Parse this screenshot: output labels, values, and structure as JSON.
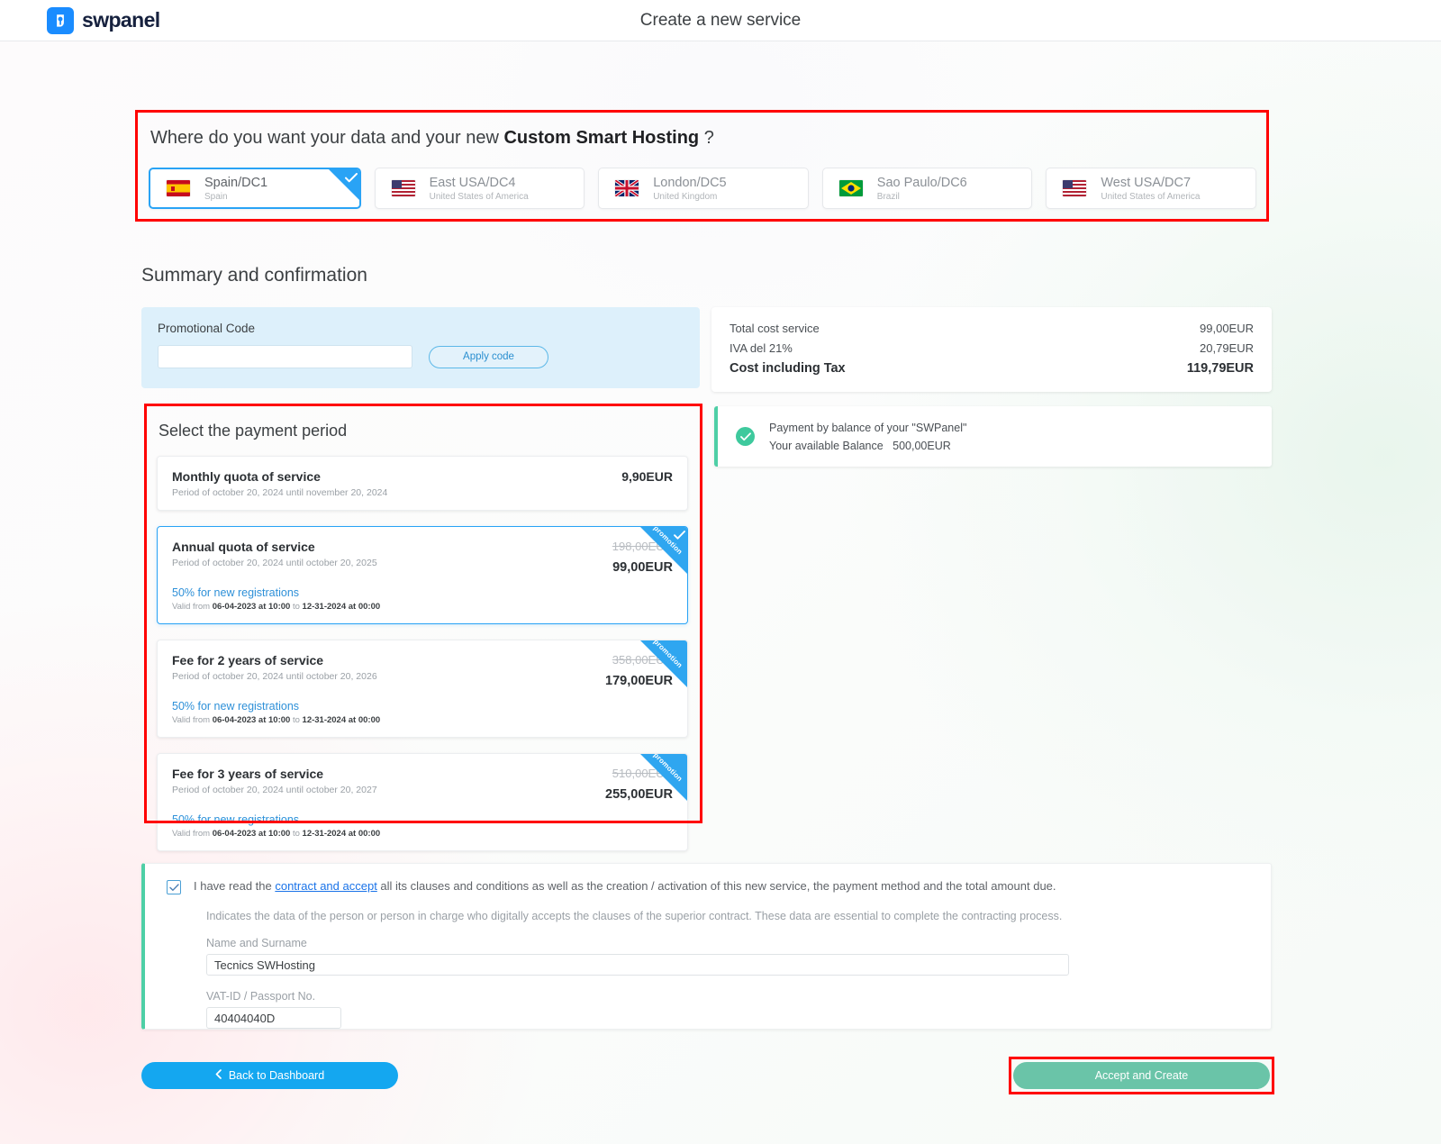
{
  "header": {
    "brand": "swpanel",
    "title": "Create a new service",
    "logo_icon": "swpanel-logo-icon",
    "brand_color": "#1a8cff"
  },
  "datacenter": {
    "question_prefix": "Where do you want your data and your new ",
    "question_bold": "Custom Smart Hosting",
    "question_suffix": " ?",
    "options": [
      {
        "name": "Spain/DC1",
        "country": "Spain",
        "flag": "flag-spain-icon",
        "selected": true
      },
      {
        "name": "East USA/DC4",
        "country": "United States of America",
        "flag": "flag-usa-icon",
        "selected": false
      },
      {
        "name": "London/DC5",
        "country": "United Kingdom",
        "flag": "flag-uk-icon",
        "selected": false
      },
      {
        "name": "Sao Paulo/DC6",
        "country": "Brazil",
        "flag": "flag-brazil-icon",
        "selected": false
      },
      {
        "name": "West USA/DC7",
        "country": "United States of America",
        "flag": "flag-usa-icon",
        "selected": false
      }
    ]
  },
  "summary": {
    "heading": "Summary and confirmation"
  },
  "promo": {
    "label": "Promotional Code",
    "value": "",
    "placeholder": "",
    "apply_label": "Apply code",
    "panel_color": "#ddf0fb"
  },
  "cost": {
    "rows": [
      {
        "label": "Total cost service",
        "value": "99,00EUR"
      },
      {
        "label": "IVA del 21%",
        "value": "20,79EUR"
      }
    ],
    "total_label": "Cost including Tax",
    "total_value": "119,79EUR"
  },
  "balance": {
    "icon": "check-circle-icon",
    "line1": "Payment by balance of your \"SWPanel\"",
    "line2_label": "Your available Balance",
    "line2_value": "500,00EUR",
    "accent_color": "#4ecfa6"
  },
  "period": {
    "title": "Select the payment period",
    "ribbon_label": "promotion",
    "options": [
      {
        "title": "Monthly quota of service",
        "subtitle": "Period of october 20, 2024 until november 20, 2024",
        "old_price": "",
        "price": "9,90EUR",
        "promo_title": "",
        "valid_prefix": "",
        "valid_from": "",
        "valid_mid": "",
        "valid_to": "",
        "has_promo": false,
        "selected": false
      },
      {
        "title": "Annual quota of service",
        "subtitle": "Period of october 20, 2024 until october 20, 2025",
        "old_price": "198,00EUR",
        "price": "99,00EUR",
        "promo_title": "50% for new registrations",
        "valid_prefix": "Valid from ",
        "valid_from": "06-04-2023 at 10:00",
        "valid_mid": " to ",
        "valid_to": "12-31-2024 at 00:00",
        "has_promo": true,
        "selected": true
      },
      {
        "title": "Fee for 2 years of service",
        "subtitle": "Period of october 20, 2024 until october 20, 2026",
        "old_price": "358,00EUR",
        "price": "179,00EUR",
        "promo_title": "50% for new registrations",
        "valid_prefix": "Valid from ",
        "valid_from": "06-04-2023 at 10:00",
        "valid_mid": " to ",
        "valid_to": "12-31-2024 at 00:00",
        "has_promo": true,
        "selected": false
      },
      {
        "title": "Fee for 3 years of service",
        "subtitle": "Period of october 20, 2024 until october 20, 2027",
        "old_price": "510,00EUR",
        "price": "255,00EUR",
        "promo_title": "50% for new registrations",
        "valid_prefix": "Valid from ",
        "valid_from": "06-04-2023 at 10:00",
        "valid_mid": " to ",
        "valid_to": "12-31-2024 at 00:00",
        "has_promo": true,
        "selected": false
      }
    ]
  },
  "contract": {
    "checked": true,
    "text_before": "I have read the ",
    "link": "contract and accept",
    "text_after": " all its clauses and conditions as well as the creation / activation of this new service, the payment method and the total amount due.",
    "note": "Indicates the data of the person or person in charge who digitally accepts the clauses of the superior contract. These data are essential to complete the contracting process.",
    "name_label": "Name and Surname",
    "name_value": "Tecnics SWHosting",
    "vat_label": "VAT-ID / Passport No.",
    "vat_value": "40404040D"
  },
  "footer": {
    "back_label": "Back to Dashboard",
    "back_icon": "chevron-left-icon",
    "accept_label": "Accept and Create",
    "back_color": "#14a7f0",
    "accept_color": "#6ac4a8"
  }
}
